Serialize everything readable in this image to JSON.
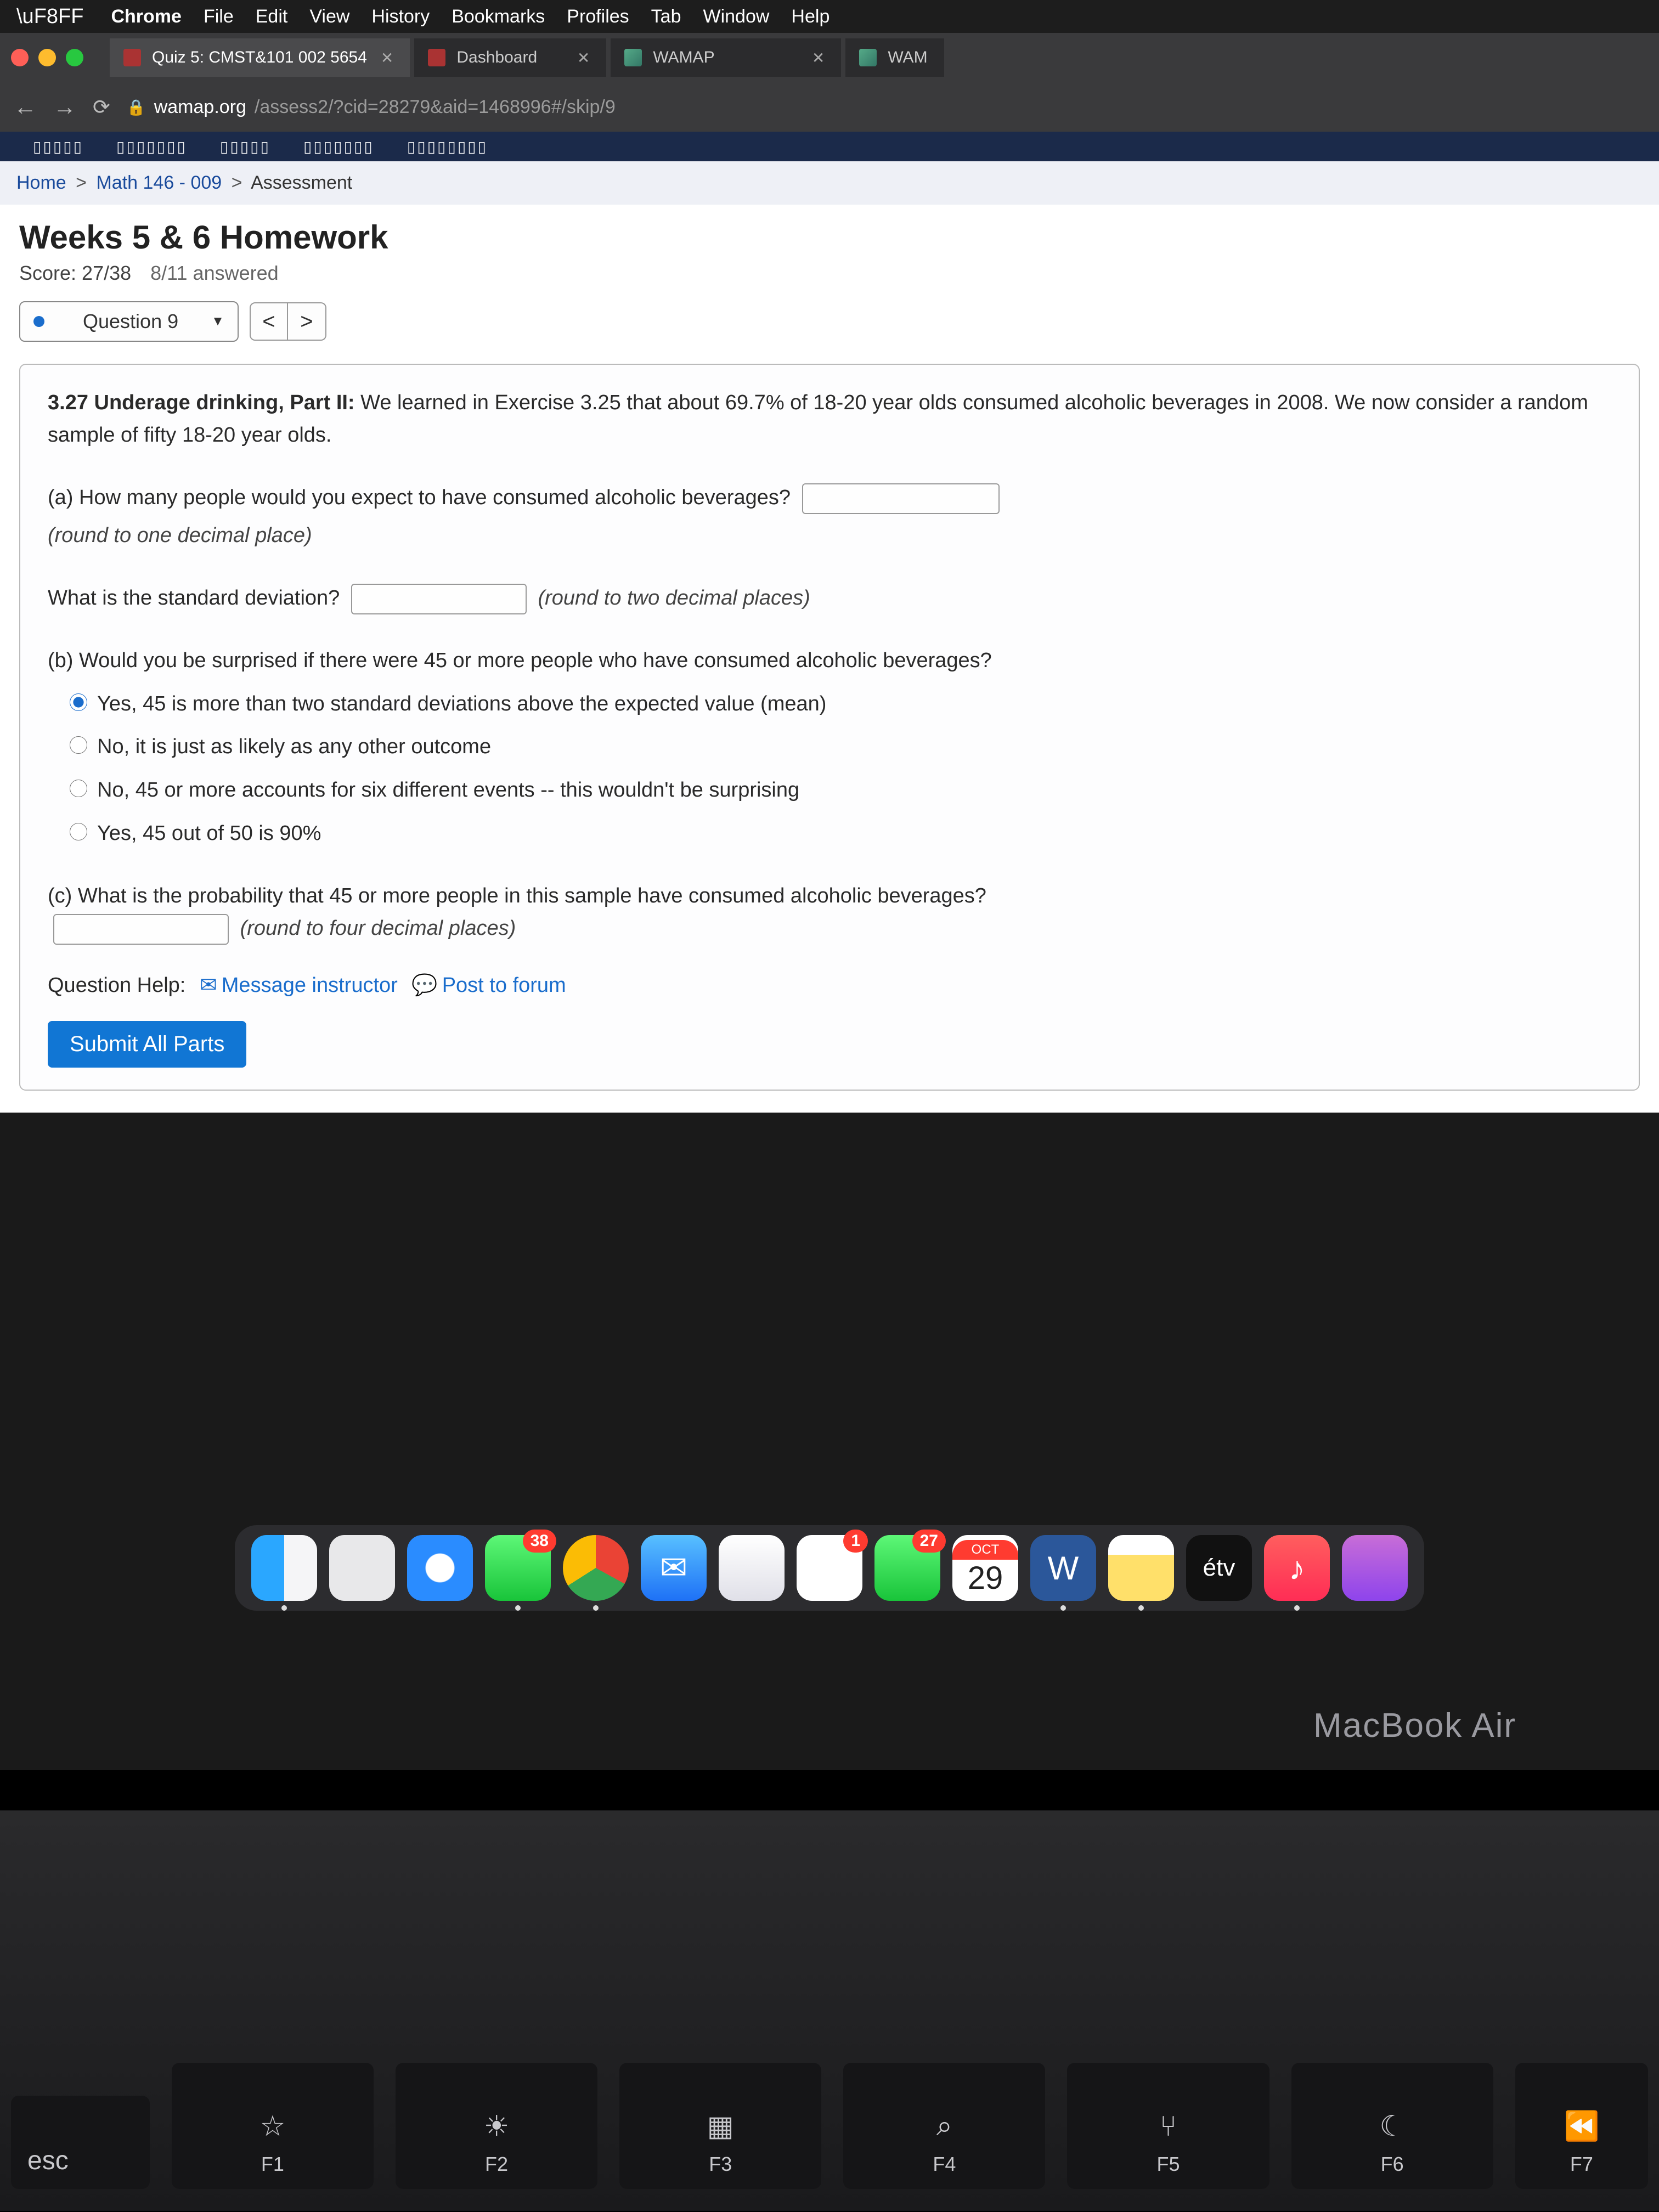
{
  "menubar": {
    "app": "Chrome",
    "items": [
      "File",
      "Edit",
      "View",
      "History",
      "Bookmarks",
      "Profiles",
      "Tab",
      "Window",
      "Help"
    ]
  },
  "tabs": [
    {
      "title": "Quiz 5: CMST&101 002 5654",
      "active": true
    },
    {
      "title": "Dashboard",
      "active": false
    },
    {
      "title": "WAMAP",
      "active": false
    },
    {
      "title": "WAM",
      "active": false
    }
  ],
  "url": {
    "host": "wamap.org",
    "path": "/assess2/?cid=28279&aid=1468996#/skip/9"
  },
  "breadcrumb": {
    "home": "Home",
    "course": "Math 146 - 009",
    "current": "Assessment"
  },
  "page": {
    "title": "Weeks 5 & 6 Homework",
    "score": "Score: 27/38",
    "answered": "8/11 answered"
  },
  "selector": {
    "label": "Question 9"
  },
  "question": {
    "header_bold": "3.27 Underage drinking, Part II:",
    "header_rest": "  We learned in Exercise 3.25 that about 69.7% of 18-20 year olds consumed alcoholic beverages in 2008. We now consider a random sample of fifty 18-20 year olds.",
    "part_a_text": "(a) How many people would you expect to have consumed alcoholic beverages?",
    "part_a_hint": "(round to one decimal place)",
    "sd_text": "What is the standard deviation?",
    "sd_hint": "(round to two decimal places)",
    "part_b_text": "(b) Would you be surprised if there were 45 or more people who have consumed alcoholic beverages?",
    "options": [
      "Yes, 45 is more than two standard deviations above the expected value (mean)",
      "No, it is just as likely as any other outcome",
      "No, 45 or more accounts for six different events -- this wouldn't be surprising",
      "Yes, 45 out of 50 is 90%"
    ],
    "selected_option": 0,
    "part_c_text": "(c) What is the probability that 45 or more people in this sample have consumed alcoholic beverages?",
    "part_c_hint": "(round to four decimal places)"
  },
  "help": {
    "label": "Question Help:",
    "message": "Message instructor",
    "forum": "Post to forum"
  },
  "submit_label": "Submit All Parts",
  "dock": {
    "messages_badge": "38",
    "photos_badge": "1",
    "facetime_badge": "27",
    "cal_month": "OCT",
    "cal_day": "29",
    "word_letter": "W",
    "tv_label": "étv",
    "music_symbol": "♪"
  },
  "laptop": "MacBook Air",
  "keys": {
    "esc": "esc",
    "f1": "F1",
    "f1_sym": "☆",
    "f2": "F2",
    "f2_sym": "☀",
    "f3": "F3",
    "f3_sym": "▦",
    "f4": "F4",
    "f4_sym": "⌕",
    "f5": "F5",
    "f5_sym": "⑂",
    "f6": "F6",
    "f6_sym": "☾",
    "f7": "F7",
    "f7_sym": "⏪"
  }
}
